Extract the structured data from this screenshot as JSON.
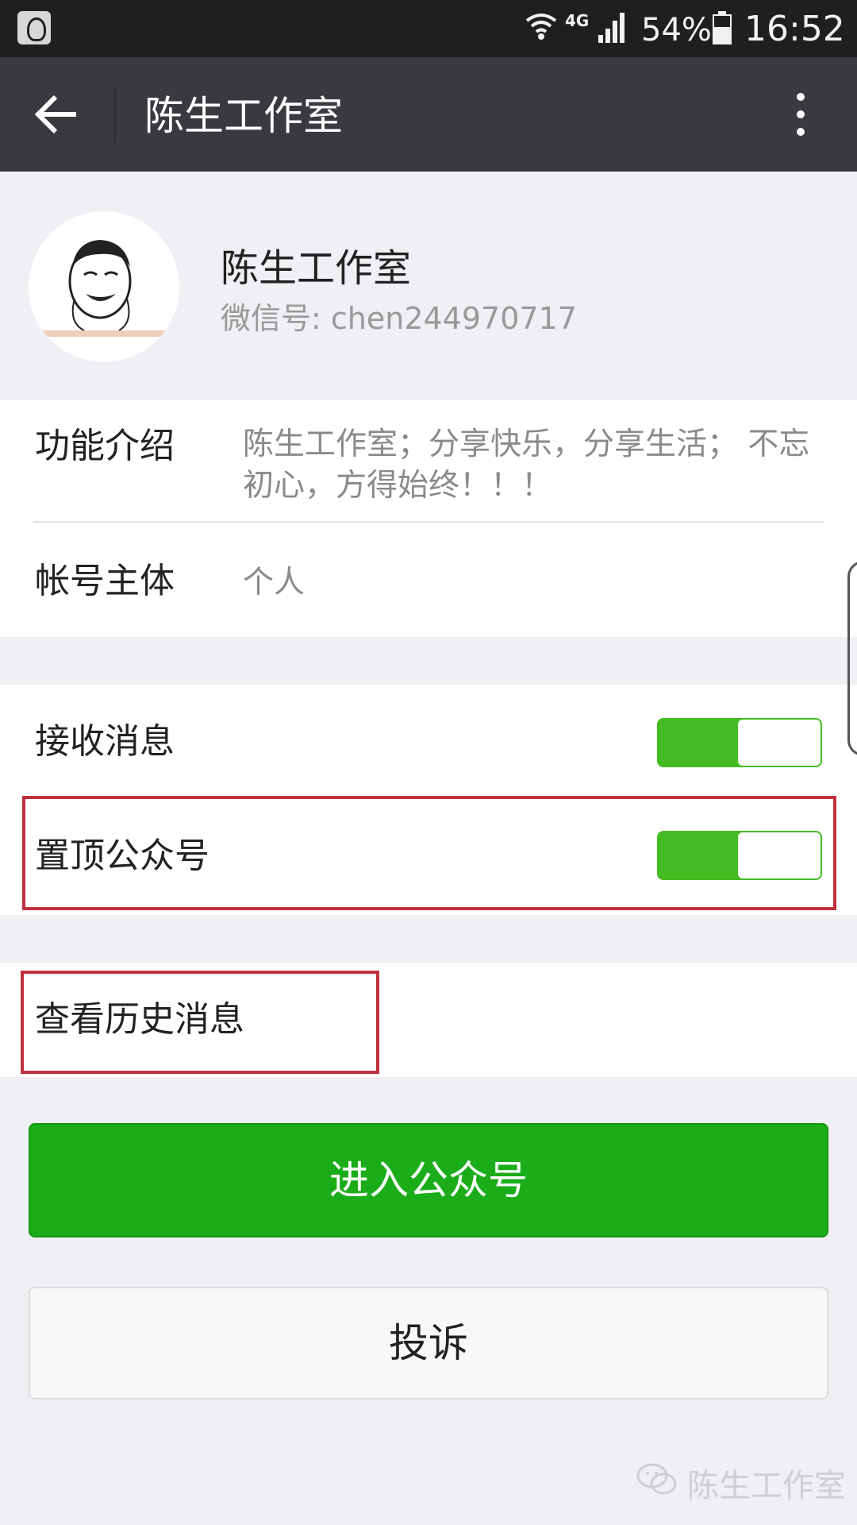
{
  "status_bar": {
    "network": "4G",
    "battery": "54%",
    "time": "16:52"
  },
  "nav": {
    "title": "陈生工作室"
  },
  "profile": {
    "name": "陈生工作室",
    "wechat_id": "微信号: chen244970717"
  },
  "info": {
    "intro_label": "功能介绍",
    "intro_value": "陈生工作室；分享快乐，分享生活； 不忘初心，方得始终！！！",
    "owner_label": "帐号主体",
    "owner_value": "个人"
  },
  "settings": {
    "receive_label": "接收消息",
    "receive_on": true,
    "pin_label": "置顶公众号",
    "pin_on": true
  },
  "history": {
    "label": "查看历史消息"
  },
  "actions": {
    "enter_label": "进入公众号",
    "report_label": "投诉"
  },
  "watermark": {
    "text": "陈生工作室"
  },
  "colors": {
    "toggle_on": "#44bb22",
    "primary_button": "#1aad19",
    "highlight": "#c0303e",
    "nav_bg": "#393a3f"
  }
}
